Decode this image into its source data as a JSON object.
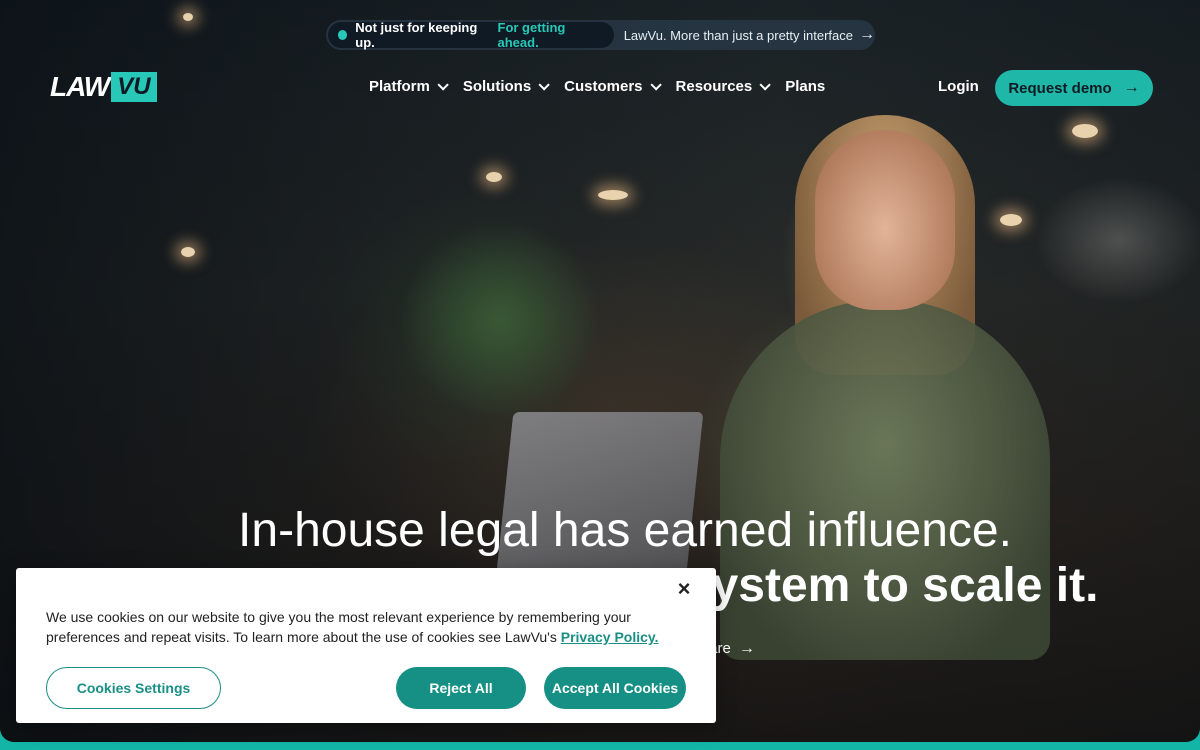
{
  "announcement": {
    "highlight_strong": "Not just for keeping up.",
    "highlight_accent": "For getting ahead.",
    "message": "LawVu. More than just a pretty interface",
    "arrow_icon": "arrow-right-icon"
  },
  "logo": {
    "part1": "LAW",
    "part2": "VU"
  },
  "nav": {
    "items": [
      {
        "label": "Platform",
        "has_dropdown": true
      },
      {
        "label": "Solutions",
        "has_dropdown": true
      },
      {
        "label": "Customers",
        "has_dropdown": true
      },
      {
        "label": "Resources",
        "has_dropdown": true
      },
      {
        "label": "Plans",
        "has_dropdown": false
      }
    ],
    "login_label": "Login",
    "demo_label": "Request demo"
  },
  "hero": {
    "headline_line1": "In-house legal has earned influence.",
    "headline_line2_visible": "ystem to scale it.",
    "compare_link": "ompare"
  },
  "cookie_banner": {
    "text": "We use cookies on our website to give you the most relevant experience by remembering your preferences and repeat visits. To learn more about the use of cookies see LawVu's ",
    "link_text": "Privacy Policy.",
    "close_icon": "close-icon",
    "settings_label": "Cookies Settings",
    "reject_label": "Reject All",
    "accept_label": "Accept All Cookies"
  },
  "colors": {
    "accent": "#28c8b8",
    "button_teal": "#168f85",
    "bottom_strip": "#12b5a6"
  }
}
